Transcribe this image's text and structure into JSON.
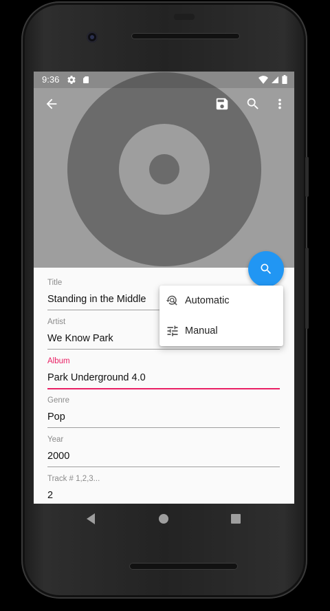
{
  "status_bar": {
    "time": "9:36"
  },
  "toolbar": {
    "back_icon": "arrow-back-icon",
    "save_icon": "save-icon",
    "search_icon": "search-icon",
    "more_icon": "more-vert-icon"
  },
  "colors": {
    "fab": "#2196f3",
    "accent": "#e91e63",
    "header_bg": "#9e9e9e"
  },
  "fields": [
    {
      "label": "Title",
      "value": "Standing in the Middle"
    },
    {
      "label": "Artist",
      "value": "We Know Park"
    },
    {
      "label": "Album",
      "value": "Park Underground 4.0"
    },
    {
      "label": "Genre",
      "value": "Pop"
    },
    {
      "label": "Year",
      "value": "2000"
    },
    {
      "label": "Track # 1,2,3...",
      "value": "2"
    }
  ],
  "menu": {
    "items": [
      {
        "label": "Automatic",
        "icon": "history-search-icon"
      },
      {
        "label": "Manual",
        "icon": "tune-icon"
      }
    ]
  },
  "navigation": {
    "back_icon": "nav-back-icon",
    "home_icon": "nav-home-icon",
    "recents_icon": "nav-recents-icon"
  }
}
